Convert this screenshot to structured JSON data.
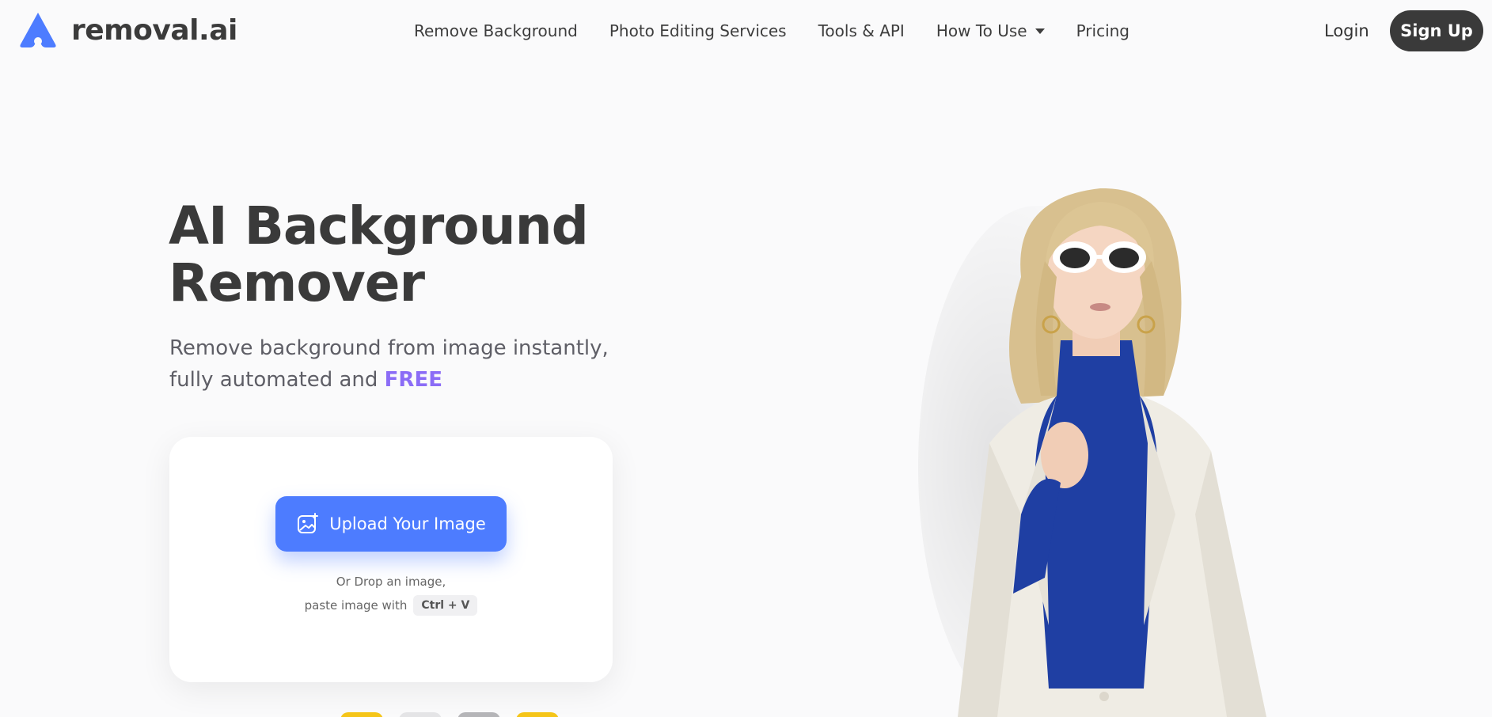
{
  "brand": {
    "name": "removal.ai",
    "accent": "#4d7cff",
    "logo_icon": "a-logo-icon"
  },
  "nav": {
    "items": [
      {
        "label": "Remove Background"
      },
      {
        "label": "Photo Editing Services"
      },
      {
        "label": "Tools & API"
      },
      {
        "label": "How To Use",
        "has_dropdown": true
      },
      {
        "label": "Pricing"
      }
    ],
    "login": "Login",
    "signup": "Sign Up"
  },
  "hero": {
    "title_line1": "AI Background",
    "title_line2": "Remover",
    "subtitle_line1": "Remove background from image instantly,",
    "subtitle_line2_prefix": "fully automated and",
    "subtitle_highlight": "FREE",
    "highlight_color": "#8b6cf6"
  },
  "upload": {
    "button_label": "Upload Your Image",
    "button_icon": "image-add-icon",
    "drop_text": "Or Drop an image,",
    "paste_text": "paste image with",
    "shortcut": "Ctrl + V"
  },
  "sample_thumbs": [
    "#f5c518",
    "#e4e4e6",
    "#b5b5b8",
    "#f5c518"
  ],
  "hero_image": {
    "subject": "woman-in-white-blazer-photo"
  }
}
